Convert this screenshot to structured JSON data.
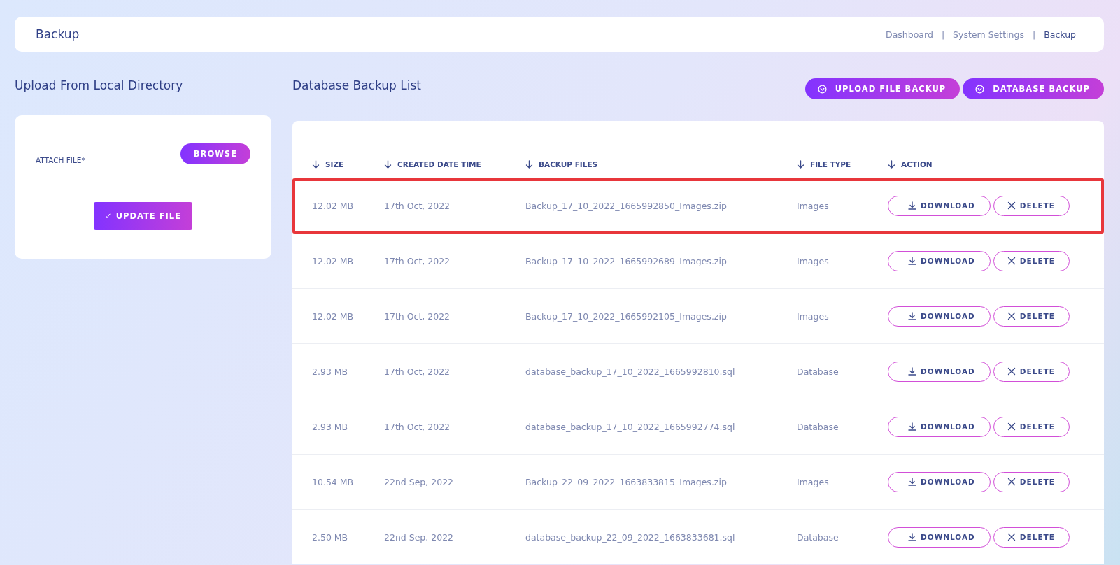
{
  "header": {
    "title": "Backup",
    "breadcrumbs": [
      {
        "label": "Dashboard",
        "selected": false
      },
      {
        "label": "System Settings",
        "selected": false
      },
      {
        "label": "Backup",
        "selected": true
      }
    ],
    "separators": [
      "|",
      "|"
    ]
  },
  "upload": {
    "title": "Upload From Local Directory",
    "field_label": "ATTACH FILE*",
    "browse_button": "BROWSE",
    "submit_button": "✓ UPDATE FILE"
  },
  "backup_list": {
    "title": "Database Backup List",
    "buttons": [
      "UPLOAD FILE BACKUP",
      "DATABASE BACKUP"
    ],
    "columns": [
      "SIZE",
      "CREATED DATE TIME",
      "BACKUP FILES",
      "FILE TYPE",
      "ACTION"
    ],
    "rows": [
      {
        "size": "12.02 MB",
        "created": "17th Oct, 2022",
        "file": "Backup_17_10_2022_1665992850_Images.zip",
        "type": "Images",
        "highlighted": true,
        "actions": [
          "DOWNLOAD",
          "DELETE"
        ]
      },
      {
        "size": "12.02 MB",
        "created": "17th Oct, 2022",
        "file": "Backup_17_10_2022_1665992689_Images.zip",
        "type": "Images",
        "highlighted": false,
        "actions": [
          "DOWNLOAD",
          "DELETE"
        ]
      },
      {
        "size": "12.02 MB",
        "created": "17th Oct, 2022",
        "file": "Backup_17_10_2022_1665992105_Images.zip",
        "type": "Images",
        "highlighted": false,
        "actions": [
          "DOWNLOAD",
          "DELETE"
        ]
      },
      {
        "size": "2.93 MB",
        "created": "17th Oct, 2022",
        "file": "database_backup_17_10_2022_1665992810.sql",
        "type": "Database",
        "highlighted": false,
        "actions": [
          "DOWNLOAD",
          "DELETE"
        ]
      },
      {
        "size": "2.93 MB",
        "created": "17th Oct, 2022",
        "file": "database_backup_17_10_2022_1665992774.sql",
        "type": "Database",
        "highlighted": false,
        "actions": [
          "DOWNLOAD",
          "DELETE"
        ]
      },
      {
        "size": "10.54 MB",
        "created": "22nd Sep, 2022",
        "file": "Backup_22_09_2022_1663833815_Images.zip",
        "type": "Images",
        "highlighted": false,
        "actions": [
          "DOWNLOAD",
          "DELETE"
        ]
      },
      {
        "size": "2.50 MB",
        "created": "22nd Sep, 2022",
        "file": "database_backup_22_09_2022_1663833681.sql",
        "type": "Database",
        "highlighted": false,
        "actions": [
          "DOWNLOAD",
          "DELETE"
        ]
      }
    ]
  }
}
